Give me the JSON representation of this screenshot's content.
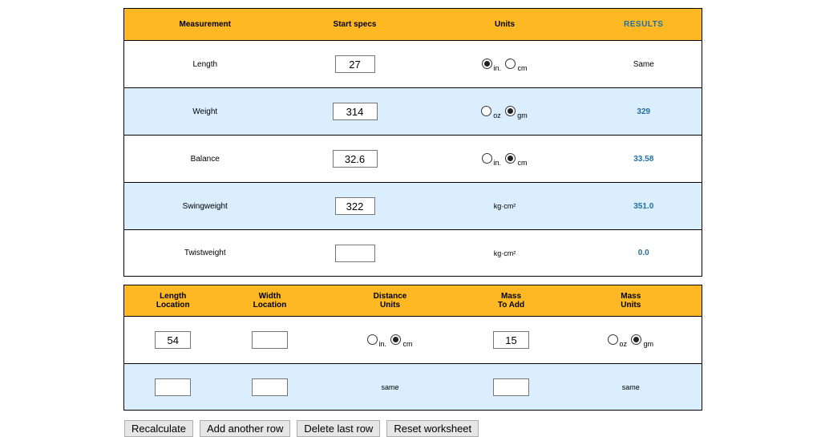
{
  "main_table": {
    "headers": {
      "measurement": "Measurement",
      "start_specs": "Start specs",
      "units": "Units",
      "results": "RESULTS"
    },
    "rows": [
      {
        "label": "Length",
        "value": "27",
        "unit_a": "in.",
        "unit_b": "cm",
        "result": "Same"
      },
      {
        "label": "Weight",
        "value": "314",
        "unit_a": "oz",
        "unit_b": "gm",
        "result": "329"
      },
      {
        "label": "Balance",
        "value": "32.6",
        "unit_a": "in.",
        "unit_b": "cm",
        "result": "33.58"
      },
      {
        "label": "Swingweight",
        "value": "322",
        "unit_text": "kg·cm²",
        "result": "351.0"
      },
      {
        "label": "Twistweight",
        "value": "",
        "unit_text": "kg·cm²",
        "result": "0.0"
      }
    ]
  },
  "mass_table": {
    "headers": {
      "length_location_1": "Length",
      "length_location_2": "Location",
      "width_location_1": "Width",
      "width_location_2": "Location",
      "distance_units_1": "Distance",
      "distance_units_2": "Units",
      "mass_to_add_1": "Mass",
      "mass_to_add_2": "To Add",
      "mass_units_1": "Mass",
      "mass_units_2": "Units"
    },
    "rows": [
      {
        "length_location": "54",
        "width_location": "",
        "dist_a": "in.",
        "dist_b": "cm",
        "mass_to_add": "15",
        "mass_a": "oz",
        "mass_b": "gm"
      },
      {
        "length_location": "",
        "width_location": "",
        "dist_same": "same",
        "mass_to_add": "",
        "mass_same": "same"
      }
    ]
  },
  "buttons": {
    "recalculate": "Recalculate",
    "add_row": "Add another row",
    "delete_row": "Delete last row",
    "reset": "Reset worksheet"
  },
  "colors": {
    "header": "#fdb824",
    "band": "#dbeefe",
    "result": "#1f6fa3"
  }
}
